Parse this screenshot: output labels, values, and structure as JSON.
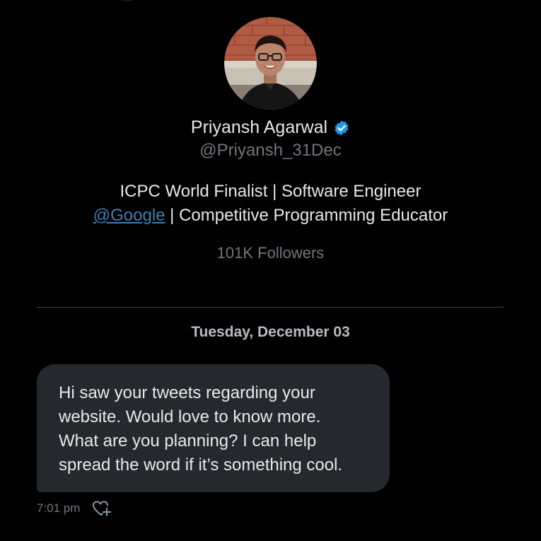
{
  "profile": {
    "name": "Priyansh Agarwal",
    "handle": "@Priyansh_31Dec",
    "bio_line1": "ICPC World Finalist | Software Engineer",
    "bio_mention": "@Google",
    "bio_line2_rest": " | Competitive Programming Educator",
    "followers": "101K Followers",
    "verified_color": "#1d9bf0"
  },
  "conversation": {
    "date_separator": "Tuesday, December 03",
    "message": {
      "text": "Hi saw your tweets regarding your\nwebsite. Would love to know more.\nWhat are you planning? I can help\nspread the word if it’s something cool.",
      "time": "7:01 pm",
      "bubble_color": "#25292e"
    }
  },
  "icons": {
    "verified": "verified-badge-icon",
    "reaction": "heart-plus-icon"
  }
}
